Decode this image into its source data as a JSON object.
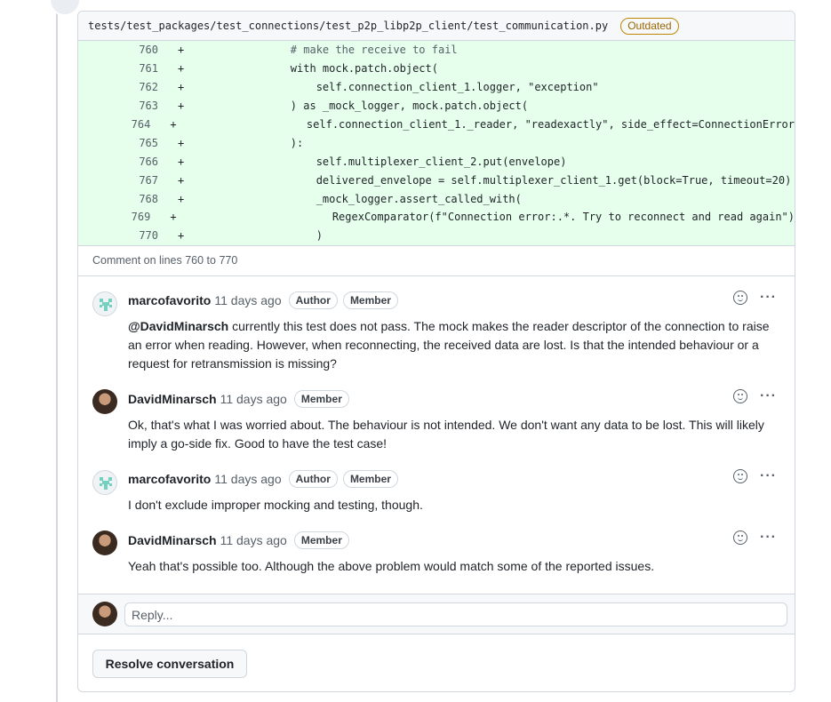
{
  "file": {
    "path": "tests/test_packages/test_connections/test_p2p_libp2p_client/test_communication.py",
    "status_badge": "Outdated"
  },
  "diff_lines": [
    {
      "num": "760",
      "sign": "+",
      "code": "        # make the receive to fail"
    },
    {
      "num": "761",
      "sign": "+",
      "code": "        with mock.patch.object("
    },
    {
      "num": "762",
      "sign": "+",
      "code": "            self.connection_client_1.logger, \"exception\""
    },
    {
      "num": "763",
      "sign": "+",
      "code": "        ) as _mock_logger, mock.patch.object("
    },
    {
      "num": "764",
      "sign": "+",
      "code": "            self.connection_client_1._reader, \"readexactly\", side_effect=ConnectionError"
    },
    {
      "num": "765",
      "sign": "+",
      "code": "        ):"
    },
    {
      "num": "766",
      "sign": "+",
      "code": "            self.multiplexer_client_2.put(envelope)"
    },
    {
      "num": "767",
      "sign": "+",
      "code": "            delivered_envelope = self.multiplexer_client_1.get(block=True, timeout=20)"
    },
    {
      "num": "768",
      "sign": "+",
      "code": "            _mock_logger.assert_called_with("
    },
    {
      "num": "769",
      "sign": "+",
      "code": "                RegexComparator(f\"Connection error:.*. Try to reconnect and read again\")"
    },
    {
      "num": "770",
      "sign": "+",
      "code": "            )"
    }
  ],
  "comment_on": "Comment on lines 760 to 770",
  "comments": [
    {
      "author": "marcofavorito",
      "time": "11 days ago",
      "badges": [
        "Author",
        "Member"
      ],
      "avatar": "identicon",
      "mention": "@DavidMinarsch",
      "body": " currently this test does not pass. The mock makes the reader descriptor of the connection to raise an error when reading. However, when reconnecting, the received data are lost. Is that the intended behaviour or a request for retransmission is missing?"
    },
    {
      "author": "DavidMinarsch",
      "time": "11 days ago",
      "badges": [
        "Member"
      ],
      "avatar": "photo",
      "mention": "",
      "body": "Ok, that's what I was worried about. The behaviour is not intended. We don't want any data to be lost. This will likely imply a go-side fix. Good to have the test case!"
    },
    {
      "author": "marcofavorito",
      "time": "11 days ago",
      "badges": [
        "Author",
        "Member"
      ],
      "avatar": "identicon",
      "mention": "",
      "body": "I don't exclude improper mocking and testing, though."
    },
    {
      "author": "DavidMinarsch",
      "time": "11 days ago",
      "badges": [
        "Member"
      ],
      "avatar": "photo",
      "mention": "",
      "body": "Yeah that's possible too. Although the above problem would match some of the reported issues."
    }
  ],
  "reply": {
    "placeholder": "Reply..."
  },
  "resolve_button": "Resolve conversation",
  "colors": {
    "diff_added_bg": "#e6ffec",
    "outdated": "#9a6700",
    "border": "#d0d7de",
    "muted_text": "#57606a"
  }
}
